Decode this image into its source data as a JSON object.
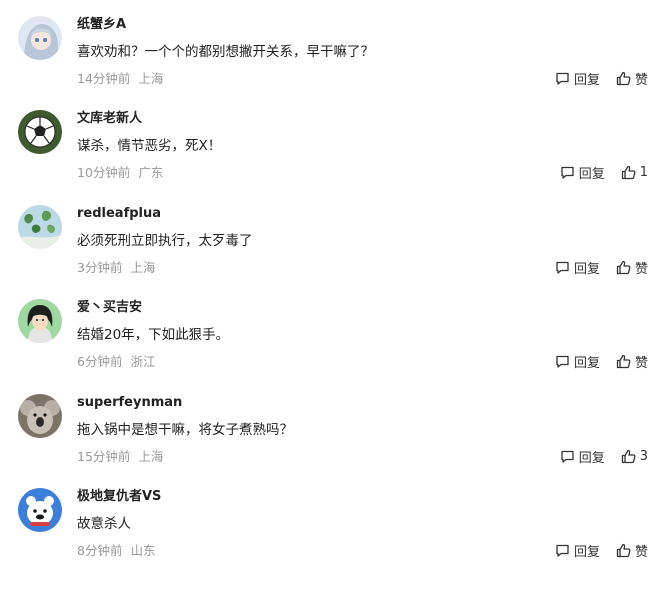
{
  "actions": {
    "reply_label": "回复",
    "like_label": "赞"
  },
  "comments": [
    {
      "username": "纸蟹乡A",
      "text": "喜欢劝和？一个个的都别想撇开关系，早干嘛了？",
      "time": "14分钟前",
      "location": "上海",
      "likes": "赞",
      "avatar": "anime-girl-avatar"
    },
    {
      "username": "文库老新人",
      "text": "谋杀，情节恶劣，死X！",
      "time": "10分钟前",
      "location": "广东",
      "likes": "1",
      "avatar": "soccer-ball-avatar"
    },
    {
      "username": "redleafplua",
      "text": "必须死刑立即执行，太歹毒了",
      "time": "3分钟前",
      "location": "上海",
      "likes": "赞",
      "avatar": "leaf-painting-avatar"
    },
    {
      "username": "爱丶买吉安",
      "text": "结婚20年，下如此狠手。",
      "time": "6分钟前",
      "location": "浙江",
      "likes": "赞",
      "avatar": "cartoon-woman-avatar"
    },
    {
      "username": "superfeynman",
      "text": "拖入锅中是想干嘛，将女子煮熟吗？",
      "time": "15分钟前",
      "location": "上海",
      "likes": "3",
      "avatar": "koala-avatar"
    },
    {
      "username": "极地复仇者VS",
      "text": "故意杀人",
      "time": "8分钟前",
      "location": "山东",
      "likes": "赞",
      "avatar": "polar-bear-avatar"
    }
  ]
}
